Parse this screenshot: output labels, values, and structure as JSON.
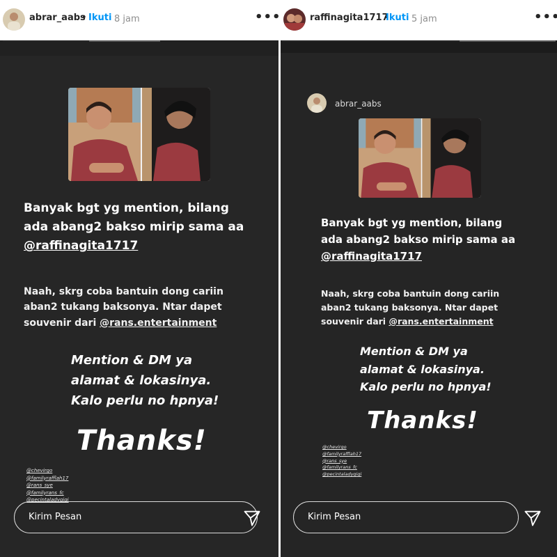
{
  "stories": [
    {
      "username": "abrar_aabs",
      "separator": "•",
      "follow_label": "Ikuti",
      "time": "8 jam",
      "more_label": "•••",
      "headline": [
        "Banyak bgt yg mention, bilang",
        "ada abang2 bakso mirip sama aa"
      ],
      "headline_mention": "@raffinagita1717",
      "body": [
        "Naah, skrg coba bantuin dong cariin",
        "aban2 tukang baksonya. Ntar dapet"
      ],
      "body_prefix": "souvenir dari ",
      "body_mention": "@rans.entertainment",
      "cta": [
        "Mention & DM ya",
        "alamat & lokasinya.",
        "Kalo perlu no hpnya!"
      ],
      "thanks": "Thanks!",
      "tags": [
        "@chevirgo",
        "@familyrafflah17",
        "@rans_sye",
        "@familyrans_fc",
        "@pecintaladygigi"
      ],
      "message_placeholder": "Kirim Pesan"
    },
    {
      "username": "raffinagita1717",
      "separator": "•",
      "follow_label": "Ikuti",
      "time": "5 jam",
      "more_label": "•••",
      "reshared_username": "abrar_aabs",
      "headline": [
        "Banyak bgt yg mention, bilang",
        "ada abang2 bakso mirip sama aa"
      ],
      "headline_mention": "@raffinagita1717",
      "body": [
        "Naah, skrg coba bantuin dong cariin",
        "aban2 tukang baksonya. Ntar dapet"
      ],
      "body_prefix": "souvenir dari ",
      "body_mention": "@rans.entertainment",
      "cta": [
        "Mention & DM ya",
        "alamat & lokasinya.",
        "Kalo perlu no hpnya!"
      ],
      "thanks": "Thanks!",
      "tags": [
        "@chevirgo",
        "@familyrafflah17",
        "@rans_sye",
        "@familyrans_fc",
        "@pecintaladygigi"
      ],
      "message_placeholder": "Kirim Pesan"
    }
  ],
  "colors": {
    "follow": "#0095f6",
    "story_bg": "#212121",
    "card_bg": "#262626",
    "shirt": "#9b3a40",
    "progress_active": "#262626"
  },
  "icons": {
    "more": "more-options-icon",
    "send": "paper-plane-send-icon"
  }
}
